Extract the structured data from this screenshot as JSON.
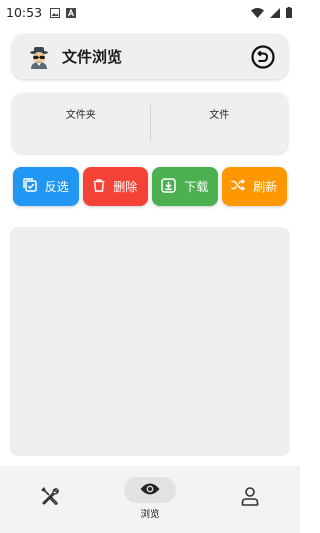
{
  "status_bar": {
    "time": "10:53"
  },
  "header": {
    "title": "文件浏览",
    "avatar_icon": "spy-avatar-icon",
    "back_icon": "back-arrow-icon"
  },
  "counts": {
    "folders_label": "文件夹",
    "files_label": "文件"
  },
  "actions": [
    {
      "label": "反选",
      "icon": "select-inverse-icon",
      "color": "#2196F3"
    },
    {
      "label": "删除",
      "icon": "trash-icon",
      "color": "#F44336"
    },
    {
      "label": "下载",
      "icon": "download-icon",
      "color": "#4CAF50"
    },
    {
      "label": "刷新",
      "icon": "shuffle-icon",
      "color": "#FF9800"
    }
  ],
  "bottom_nav": [
    {
      "label": "",
      "icon": "tools-icon",
      "active": false
    },
    {
      "label": "浏览",
      "icon": "eye-icon",
      "active": true
    },
    {
      "label": "",
      "icon": "person-icon",
      "active": false
    }
  ]
}
